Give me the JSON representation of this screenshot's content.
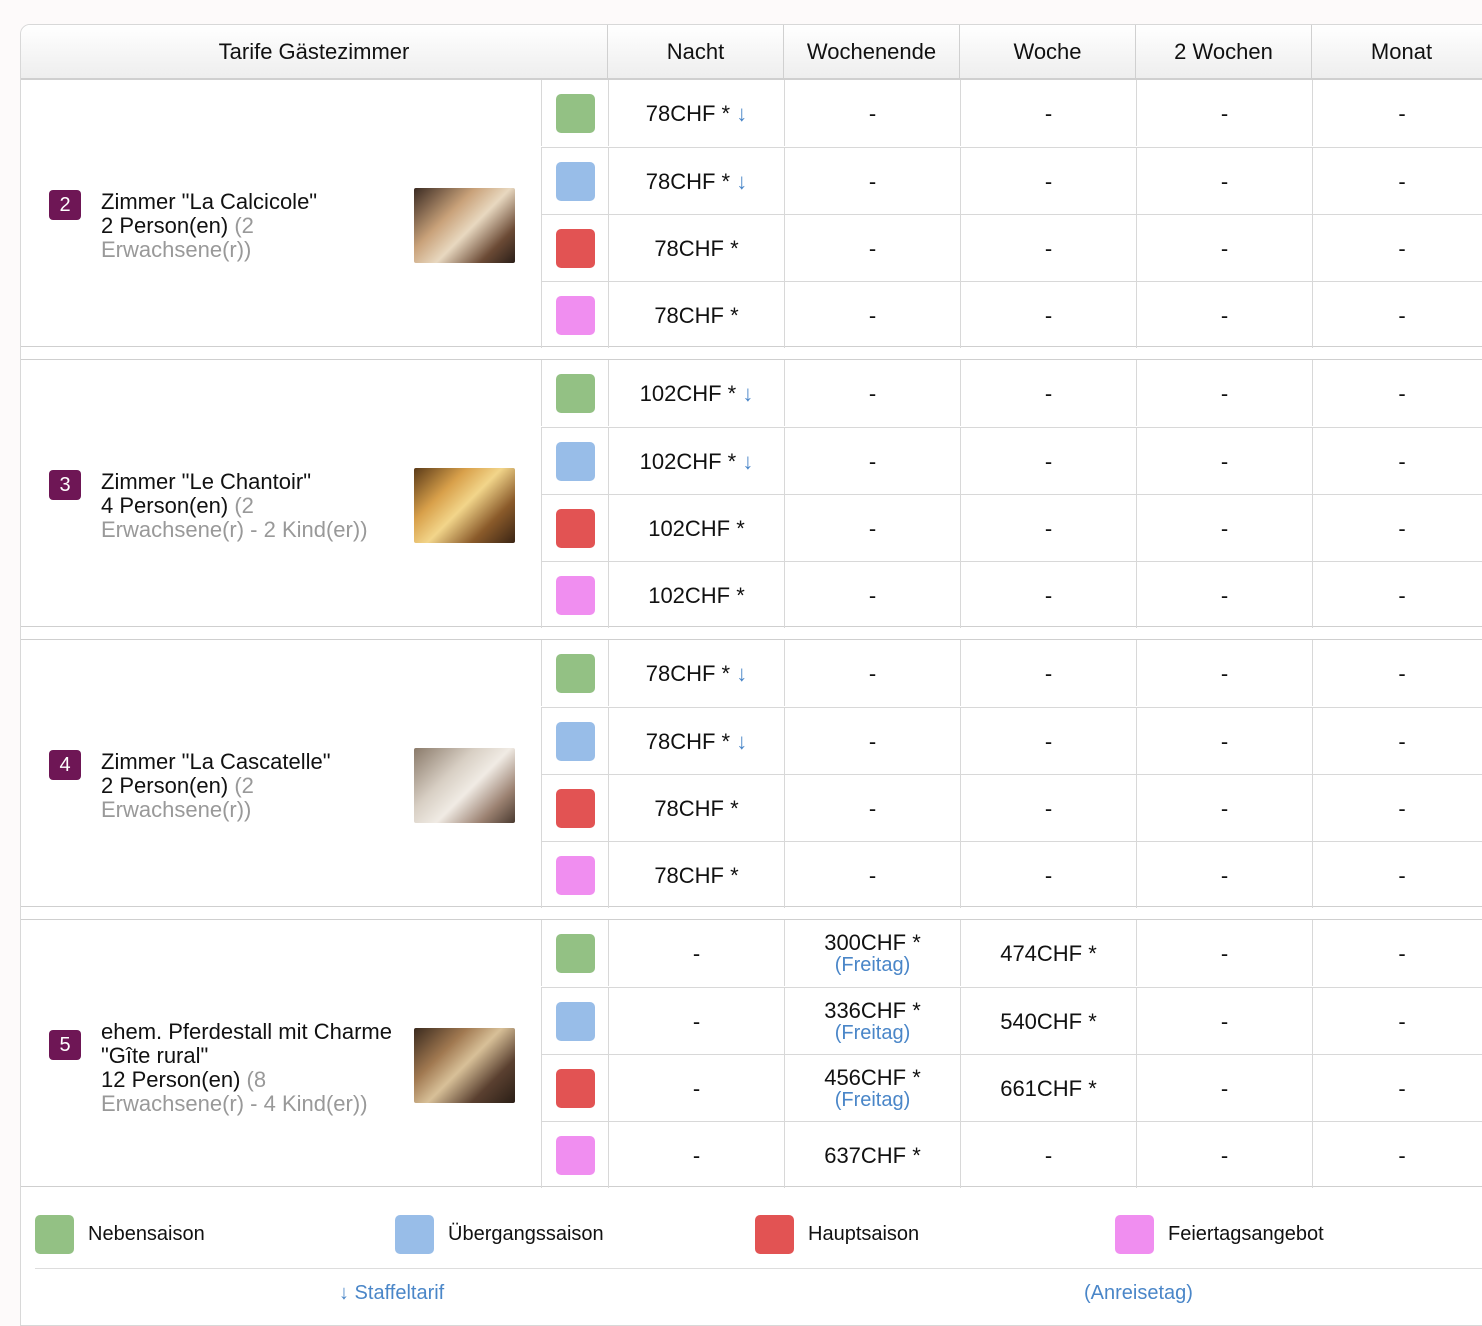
{
  "header": {
    "title": "Tarife Gästezimmer",
    "columns": [
      "Nacht",
      "Wochenende",
      "Woche",
      "2 Wochen",
      "Monat"
    ]
  },
  "colors": {
    "nebensaison": "#93c184",
    "uebergangssaison": "#98bde8",
    "hauptsaison": "#e25353",
    "feiertagsangebot": "#f08ef0",
    "badge": "#6e1655",
    "link": "#4a86c8"
  },
  "rooms": [
    {
      "number": "2",
      "name": "Zimmer \"La Calcicole\"",
      "persons": "2 Person(en)",
      "detail_open": "(2",
      "detail_rest": "Erwachsene(r))",
      "rows": [
        {
          "season": "nebensaison",
          "nacht": "78CHF *",
          "arrow": "↓",
          "wochenende": "-",
          "wochenende_note": "",
          "woche": "-",
          "zweiwochen": "-",
          "monat": "-"
        },
        {
          "season": "uebergangssaison",
          "nacht": "78CHF *",
          "arrow": "↓",
          "wochenende": "-",
          "wochenende_note": "",
          "woche": "-",
          "zweiwochen": "-",
          "monat": "-"
        },
        {
          "season": "hauptsaison",
          "nacht": "78CHF *",
          "arrow": "",
          "wochenende": "-",
          "wochenende_note": "",
          "woche": "-",
          "zweiwochen": "-",
          "monat": "-"
        },
        {
          "season": "feiertagsangebot",
          "nacht": "78CHF *",
          "arrow": "",
          "wochenende": "-",
          "wochenende_note": "",
          "woche": "-",
          "zweiwochen": "-",
          "monat": "-"
        }
      ]
    },
    {
      "number": "3",
      "name": "Zimmer \"Le Chantoir\"",
      "persons": "4 Person(en)",
      "detail_open": "(2",
      "detail_rest": "Erwachsene(r) - 2 Kind(er))",
      "rows": [
        {
          "season": "nebensaison",
          "nacht": "102CHF *",
          "arrow": "↓",
          "wochenende": "-",
          "wochenende_note": "",
          "woche": "-",
          "zweiwochen": "-",
          "monat": "-"
        },
        {
          "season": "uebergangssaison",
          "nacht": "102CHF *",
          "arrow": "↓",
          "wochenende": "-",
          "wochenende_note": "",
          "woche": "-",
          "zweiwochen": "-",
          "monat": "-"
        },
        {
          "season": "hauptsaison",
          "nacht": "102CHF *",
          "arrow": "",
          "wochenende": "-",
          "wochenende_note": "",
          "woche": "-",
          "zweiwochen": "-",
          "monat": "-"
        },
        {
          "season": "feiertagsangebot",
          "nacht": "102CHF *",
          "arrow": "",
          "wochenende": "-",
          "wochenende_note": "",
          "woche": "-",
          "zweiwochen": "-",
          "monat": "-"
        }
      ]
    },
    {
      "number": "4",
      "name": "Zimmer \"La Cascatelle\"",
      "persons": "2 Person(en)",
      "detail_open": "(2",
      "detail_rest": "Erwachsene(r))",
      "rows": [
        {
          "season": "nebensaison",
          "nacht": "78CHF *",
          "arrow": "↓",
          "wochenende": "-",
          "wochenende_note": "",
          "woche": "-",
          "zweiwochen": "-",
          "monat": "-"
        },
        {
          "season": "uebergangssaison",
          "nacht": "78CHF *",
          "arrow": "↓",
          "wochenende": "-",
          "wochenende_note": "",
          "woche": "-",
          "zweiwochen": "-",
          "monat": "-"
        },
        {
          "season": "hauptsaison",
          "nacht": "78CHF *",
          "arrow": "",
          "wochenende": "-",
          "wochenende_note": "",
          "woche": "-",
          "zweiwochen": "-",
          "monat": "-"
        },
        {
          "season": "feiertagsangebot",
          "nacht": "78CHF *",
          "arrow": "",
          "wochenende": "-",
          "wochenende_note": "",
          "woche": "-",
          "zweiwochen": "-",
          "monat": "-"
        }
      ]
    },
    {
      "number": "5",
      "name": "ehem. Pferdestall mit Charme \"Gîte rural\"",
      "persons": "12 Person(en)",
      "detail_open": "(8",
      "detail_rest": "Erwachsene(r) - 4 Kind(er))",
      "rows": [
        {
          "season": "nebensaison",
          "nacht": "-",
          "arrow": "",
          "wochenende": "300CHF *",
          "wochenende_note": "(Freitag)",
          "woche": "474CHF *",
          "zweiwochen": "-",
          "monat": "-"
        },
        {
          "season": "uebergangssaison",
          "nacht": "-",
          "arrow": "",
          "wochenende": "336CHF *",
          "wochenende_note": "(Freitag)",
          "woche": "540CHF *",
          "zweiwochen": "-",
          "monat": "-"
        },
        {
          "season": "hauptsaison",
          "nacht": "-",
          "arrow": "",
          "wochenende": "456CHF *",
          "wochenende_note": "(Freitag)",
          "woche": "661CHF *",
          "zweiwochen": "-",
          "monat": "-"
        },
        {
          "season": "feiertagsangebot",
          "nacht": "-",
          "arrow": "",
          "wochenende": "637CHF *",
          "wochenende_note": "",
          "woche": "-",
          "zweiwochen": "-",
          "monat": "-"
        }
      ]
    }
  ],
  "legend": {
    "items": [
      {
        "key": "nebensaison",
        "label": "Nebensaison"
      },
      {
        "key": "uebergangssaison",
        "label": "Übergangssaison"
      },
      {
        "key": "hauptsaison",
        "label": "Hauptsaison"
      },
      {
        "key": "feiertagsangebot",
        "label": "Feiertagsangebot"
      }
    ],
    "staffel_note": "↓ Staffeltarif",
    "anreise_note": "(Anreisetag)"
  }
}
